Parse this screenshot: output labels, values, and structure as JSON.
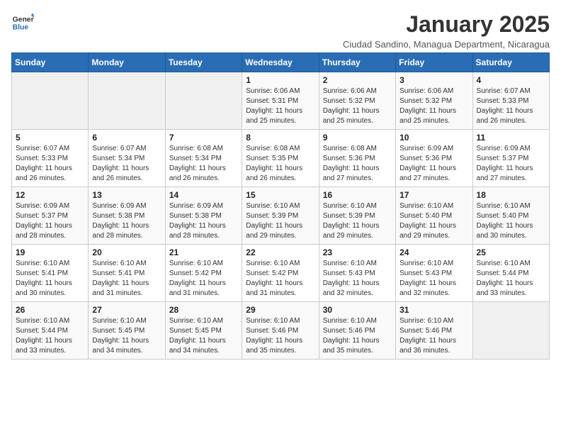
{
  "logo": {
    "text_general": "General",
    "text_blue": "Blue"
  },
  "header": {
    "title": "January 2025",
    "subtitle": "Ciudad Sandino, Managua Department, Nicaragua"
  },
  "weekdays": [
    "Sunday",
    "Monday",
    "Tuesday",
    "Wednesday",
    "Thursday",
    "Friday",
    "Saturday"
  ],
  "weeks": [
    [
      {
        "day": "",
        "empty": true
      },
      {
        "day": "",
        "empty": true
      },
      {
        "day": "",
        "empty": true
      },
      {
        "day": "1",
        "sunrise": "6:06 AM",
        "sunset": "5:31 PM",
        "daylight": "11 hours and 25 minutes."
      },
      {
        "day": "2",
        "sunrise": "6:06 AM",
        "sunset": "5:32 PM",
        "daylight": "11 hours and 25 minutes."
      },
      {
        "day": "3",
        "sunrise": "6:06 AM",
        "sunset": "5:32 PM",
        "daylight": "11 hours and 25 minutes."
      },
      {
        "day": "4",
        "sunrise": "6:07 AM",
        "sunset": "5:33 PM",
        "daylight": "11 hours and 26 minutes."
      }
    ],
    [
      {
        "day": "5",
        "sunrise": "6:07 AM",
        "sunset": "5:33 PM",
        "daylight": "11 hours and 26 minutes."
      },
      {
        "day": "6",
        "sunrise": "6:07 AM",
        "sunset": "5:34 PM",
        "daylight": "11 hours and 26 minutes."
      },
      {
        "day": "7",
        "sunrise": "6:08 AM",
        "sunset": "5:34 PM",
        "daylight": "11 hours and 26 minutes."
      },
      {
        "day": "8",
        "sunrise": "6:08 AM",
        "sunset": "5:35 PM",
        "daylight": "11 hours and 26 minutes."
      },
      {
        "day": "9",
        "sunrise": "6:08 AM",
        "sunset": "5:36 PM",
        "daylight": "11 hours and 27 minutes."
      },
      {
        "day": "10",
        "sunrise": "6:09 AM",
        "sunset": "5:36 PM",
        "daylight": "11 hours and 27 minutes."
      },
      {
        "day": "11",
        "sunrise": "6:09 AM",
        "sunset": "5:37 PM",
        "daylight": "11 hours and 27 minutes."
      }
    ],
    [
      {
        "day": "12",
        "sunrise": "6:09 AM",
        "sunset": "5:37 PM",
        "daylight": "11 hours and 28 minutes."
      },
      {
        "day": "13",
        "sunrise": "6:09 AM",
        "sunset": "5:38 PM",
        "daylight": "11 hours and 28 minutes."
      },
      {
        "day": "14",
        "sunrise": "6:09 AM",
        "sunset": "5:38 PM",
        "daylight": "11 hours and 28 minutes."
      },
      {
        "day": "15",
        "sunrise": "6:10 AM",
        "sunset": "5:39 PM",
        "daylight": "11 hours and 29 minutes."
      },
      {
        "day": "16",
        "sunrise": "6:10 AM",
        "sunset": "5:39 PM",
        "daylight": "11 hours and 29 minutes."
      },
      {
        "day": "17",
        "sunrise": "6:10 AM",
        "sunset": "5:40 PM",
        "daylight": "11 hours and 29 minutes."
      },
      {
        "day": "18",
        "sunrise": "6:10 AM",
        "sunset": "5:40 PM",
        "daylight": "11 hours and 30 minutes."
      }
    ],
    [
      {
        "day": "19",
        "sunrise": "6:10 AM",
        "sunset": "5:41 PM",
        "daylight": "11 hours and 30 minutes."
      },
      {
        "day": "20",
        "sunrise": "6:10 AM",
        "sunset": "5:41 PM",
        "daylight": "11 hours and 31 minutes."
      },
      {
        "day": "21",
        "sunrise": "6:10 AM",
        "sunset": "5:42 PM",
        "daylight": "11 hours and 31 minutes."
      },
      {
        "day": "22",
        "sunrise": "6:10 AM",
        "sunset": "5:42 PM",
        "daylight": "11 hours and 31 minutes."
      },
      {
        "day": "23",
        "sunrise": "6:10 AM",
        "sunset": "5:43 PM",
        "daylight": "11 hours and 32 minutes."
      },
      {
        "day": "24",
        "sunrise": "6:10 AM",
        "sunset": "5:43 PM",
        "daylight": "11 hours and 32 minutes."
      },
      {
        "day": "25",
        "sunrise": "6:10 AM",
        "sunset": "5:44 PM",
        "daylight": "11 hours and 33 minutes."
      }
    ],
    [
      {
        "day": "26",
        "sunrise": "6:10 AM",
        "sunset": "5:44 PM",
        "daylight": "11 hours and 33 minutes."
      },
      {
        "day": "27",
        "sunrise": "6:10 AM",
        "sunset": "5:45 PM",
        "daylight": "11 hours and 34 minutes."
      },
      {
        "day": "28",
        "sunrise": "6:10 AM",
        "sunset": "5:45 PM",
        "daylight": "11 hours and 34 minutes."
      },
      {
        "day": "29",
        "sunrise": "6:10 AM",
        "sunset": "5:46 PM",
        "daylight": "11 hours and 35 minutes."
      },
      {
        "day": "30",
        "sunrise": "6:10 AM",
        "sunset": "5:46 PM",
        "daylight": "11 hours and 35 minutes."
      },
      {
        "day": "31",
        "sunrise": "6:10 AM",
        "sunset": "5:46 PM",
        "daylight": "11 hours and 36 minutes."
      },
      {
        "day": "",
        "empty": true
      }
    ]
  ],
  "labels": {
    "sunrise": "Sunrise:",
    "sunset": "Sunset:",
    "daylight": "Daylight:"
  }
}
